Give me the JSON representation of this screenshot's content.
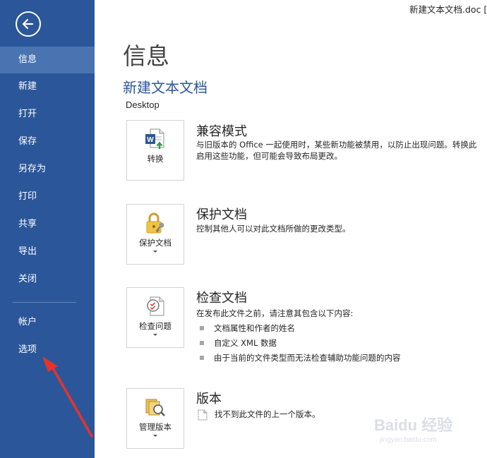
{
  "window": {
    "title": "新建文本文档.doc [兼"
  },
  "sidebar": {
    "items": [
      {
        "label": "信息"
      },
      {
        "label": "新建"
      },
      {
        "label": "打开"
      },
      {
        "label": "保存"
      },
      {
        "label": "另存为"
      },
      {
        "label": "打印"
      },
      {
        "label": "共享"
      },
      {
        "label": "导出"
      },
      {
        "label": "关闭"
      },
      {
        "label": "帐户"
      },
      {
        "label": "选项"
      }
    ],
    "active_index": 0
  },
  "main": {
    "title": "信息",
    "doc_name": "新建文本文档",
    "doc_location": "Desktop",
    "sections": {
      "compat": {
        "tile_label": "转换",
        "icon": "word-convert-icon",
        "title": "兼容模式",
        "desc_line1": "与旧版本的 Office 一起使用时，某些新功能被禁用，以防止出现问题。转换此",
        "desc_line2": "启用这些功能，但可能会导致布局更改。"
      },
      "protect": {
        "tile_label": "保护文档",
        "icon": "lock-key-icon",
        "title": "保护文档",
        "desc": "控制其他人可以对此文档所做的更改类型。"
      },
      "inspect": {
        "tile_label": "检查问题",
        "icon": "inspect-document-icon",
        "title": "检查文档",
        "desc": "在发布此文件之前，请注意其包含以下内容:",
        "bullets": [
          "文档属性和作者的姓名",
          "自定义 XML 数据",
          "由于当前的文件类型而无法检查辅助功能问题的内容"
        ]
      },
      "versions": {
        "tile_label": "管理版本",
        "icon": "manage-versions-icon",
        "title": "版本",
        "desc": "找不到此文件的上一个版本。"
      }
    }
  },
  "watermark": {
    "main": "Baidu 经验",
    "sub": "jingyan.baidu.com"
  },
  "colors": {
    "sidebar_bg": "#2b579a",
    "sidebar_active": "#4a74b1",
    "accent": "#2b579a",
    "annotation": "#e8322b"
  }
}
